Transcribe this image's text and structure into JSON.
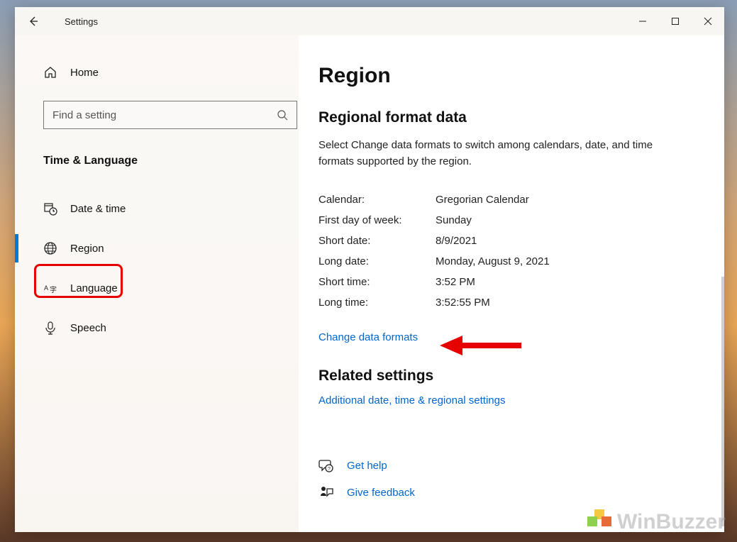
{
  "titlebar": {
    "title": "Settings"
  },
  "sidebar": {
    "home_label": "Home",
    "search_placeholder": "Find a setting",
    "category_header": "Time & Language",
    "items": [
      {
        "label": "Date & time"
      },
      {
        "label": "Region"
      },
      {
        "label": "Language"
      },
      {
        "label": "Speech"
      }
    ]
  },
  "content": {
    "page_title": "Region",
    "section_title": "Regional format data",
    "section_desc": "Select Change data formats to switch among calendars, date, and time formats supported by the region.",
    "rows": [
      {
        "label": "Calendar:",
        "value": "Gregorian Calendar"
      },
      {
        "label": "First day of week:",
        "value": "Sunday"
      },
      {
        "label": "Short date:",
        "value": "8/9/2021"
      },
      {
        "label": "Long date:",
        "value": "Monday, August 9, 2021"
      },
      {
        "label": "Short time:",
        "value": "3:52 PM"
      },
      {
        "label": "Long time:",
        "value": "3:52:55 PM"
      }
    ],
    "change_formats_link": "Change data formats",
    "related_title": "Related settings",
    "related_link": "Additional date, time & regional settings",
    "get_help_label": "Get help",
    "give_feedback_label": "Give feedback"
  },
  "watermark": "WinBuzzer"
}
